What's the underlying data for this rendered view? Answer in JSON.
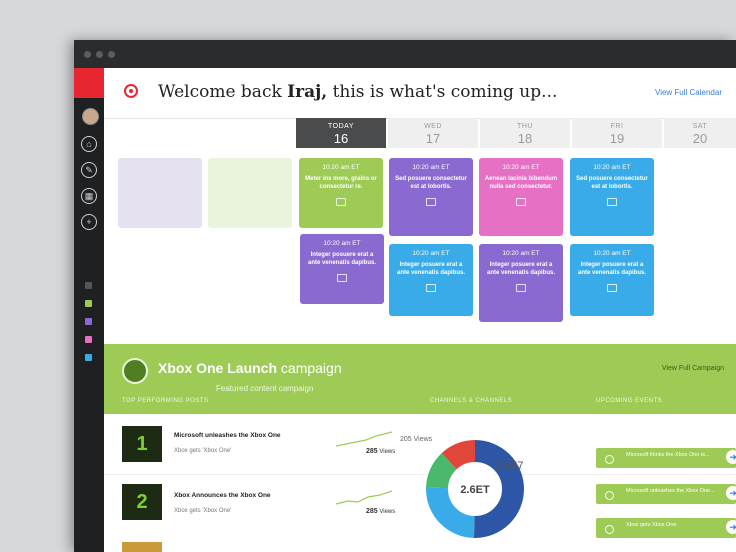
{
  "header": {
    "welcome_prefix": "Welcome back",
    "welcome_name": "Iraj,",
    "welcome_suffix": "this is what's coming up...",
    "full_calendar_link": "View Full Calendar"
  },
  "calendar": {
    "days": [
      {
        "name": "TODAY",
        "date": "16"
      },
      {
        "name": "WED",
        "date": "17"
      },
      {
        "name": "THU",
        "date": "18"
      },
      {
        "name": "FRI",
        "date": "19"
      },
      {
        "name": "SAT",
        "date": "20"
      }
    ],
    "cards": [
      {
        "time": "10:20 am ET",
        "text": "Meter ins more, grains or consectetur re.",
        "color": "#9dcb56"
      },
      {
        "time": "10:20 am ET",
        "text": "Sed posuere consectetur est at lobortis.",
        "color": "#8a6ad0"
      },
      {
        "time": "10:20 am ET",
        "text": "Aenean lacinia bibendum nulla sed consectetur.",
        "color": "#e570c4"
      },
      {
        "time": "10:20 am ET",
        "text": "Sed posuere consectetur est at lobortis.",
        "color": "#3aabe9"
      },
      {
        "time": "10:20 am ET",
        "text": "Integer posuere erat a ante venenatis dapibus.",
        "color": "#8a6ad0"
      },
      {
        "time": "10:20 am ET",
        "text": "Integer posuere erat a ante venenatis dapibus.",
        "color": "#3aabe9"
      },
      {
        "time": "10:20 am ET",
        "text": "Integer posuere erat a ante venenatis dapibus.",
        "color": "#8a6ad0"
      },
      {
        "time": "10:20 am ET",
        "text": "Integer posuere erat a ante venenatis dapibus.",
        "color": "#3aabe9"
      }
    ]
  },
  "campaign": {
    "title_bold": "Xbox One Launch",
    "title_rest": "campaign",
    "subtitle": "Featured content campaign",
    "view_link": "View Full Campaign",
    "col_top_posts": "TOP PERFORMING POSTS",
    "col_channels": "CHANNELS & CHANNELS",
    "col_upcoming": "UPCOMING EVENTS",
    "posts": [
      {
        "rank": "1",
        "title": "Microsoft unleashes the Xbox One",
        "sub": "Xbox gets 'Xbox One'",
        "views": "285",
        "views_label": "Views"
      },
      {
        "rank": "2",
        "title": "Xbox Announces the Xbox One",
        "sub": "Xbox gets 'Xbox One'",
        "views": "285",
        "views_label": "Views"
      }
    ],
    "donut_label": "205 Views",
    "donut_center": "2.6ET",
    "donut_value": "2,657",
    "upcoming": [
      {
        "text": "Microsoft thinks the Xbox One is..."
      },
      {
        "text": "Microsoft unleashes the Xbox One..."
      },
      {
        "text": "Xbox gets Xbox One"
      }
    ]
  },
  "colors": {
    "accent_red": "#e8262f",
    "green": "#9dcb56",
    "purple": "#8a6ad0",
    "pink": "#e570c4",
    "blue": "#3aabe9"
  }
}
